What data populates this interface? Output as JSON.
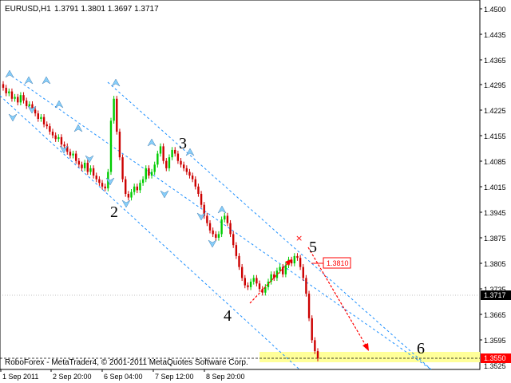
{
  "header": {
    "symbol": "EURUSD,H1",
    "ohlc": "1.3791 1.3801 1.3697 1.3717"
  },
  "footer": {
    "copyright": "RoboForex - MetaTrader4, © 2001-2011 MetaQuotes Software Corp."
  },
  "price_axis": {
    "ticks": [
      "1.4500",
      "1.4435",
      "1.4365",
      "1.4295",
      "1.4225",
      "1.4155",
      "1.4085",
      "1.4015",
      "1.3945",
      "1.3875",
      "1.3805",
      "1.3735",
      "1.3665",
      "1.3595",
      "1.3525"
    ],
    "current_price_label": "1.3717",
    "target_label": "1.3550"
  },
  "time_axis": {
    "ticks": [
      "1 Sep 2011",
      "2 Sep 20:00",
      "6 Sep 04:00",
      "7 Sep 12:00",
      "8 Sep 20:00"
    ]
  },
  "annotations": {
    "waves": [
      "2",
      "3",
      "4",
      "5",
      "6"
    ],
    "level_label": "1.3810"
  },
  "colors": {
    "bull": "#00cc00",
    "bear": "#cc0000",
    "channel": "#1e90ff",
    "fractal": "#87cefa",
    "target_zone": "#ffff99",
    "forecast_arrow": "#ff0000",
    "price_tag_bg": "#000000"
  },
  "chart_data": {
    "type": "candlestick",
    "symbol": "EURUSD",
    "timeframe": "H1",
    "ylim": [
      1.351,
      1.452
    ],
    "close_series": [
      1.428,
      1.4265,
      1.427,
      1.425,
      1.4255,
      1.424,
      1.426,
      1.4245,
      1.423,
      1.4235,
      1.422,
      1.421,
      1.4195,
      1.42,
      1.418,
      1.4175,
      1.416,
      1.415,
      1.414,
      1.4145,
      1.4125,
      1.412,
      1.4105,
      1.4095,
      1.41,
      1.408,
      1.407,
      1.406,
      1.4075,
      1.405,
      1.406,
      1.404,
      1.403,
      1.402,
      1.401,
      1.4005,
      1.405,
      1.419,
      1.425,
      1.416,
      1.409,
      1.403,
      1.399,
      1.398,
      1.3995,
      1.401,
      1.4,
      1.402,
      1.403,
      1.406,
      1.404,
      1.405,
      1.407,
      1.41,
      1.412,
      1.408,
      1.406,
      1.409,
      1.411,
      1.41,
      1.408,
      1.407,
      1.406,
      1.405,
      1.404,
      1.403,
      1.401,
      1.399,
      1.396,
      1.393,
      1.391,
      1.389,
      1.388,
      1.387,
      1.388,
      1.392,
      1.393,
      1.391,
      1.388,
      1.385,
      1.382,
      1.379,
      1.376,
      1.374,
      1.3735,
      1.375,
      1.376,
      1.3745,
      1.373,
      1.372,
      1.3735,
      1.375,
      1.377,
      1.376,
      1.378,
      1.379,
      1.377,
      1.3795,
      1.381,
      1.38,
      1.382,
      1.3815,
      1.379,
      1.376,
      1.3717,
      1.365,
      1.359,
      1.356,
      1.354
    ],
    "target_level": 1.355,
    "resistance_level": 1.381,
    "current_price": 1.3717
  }
}
